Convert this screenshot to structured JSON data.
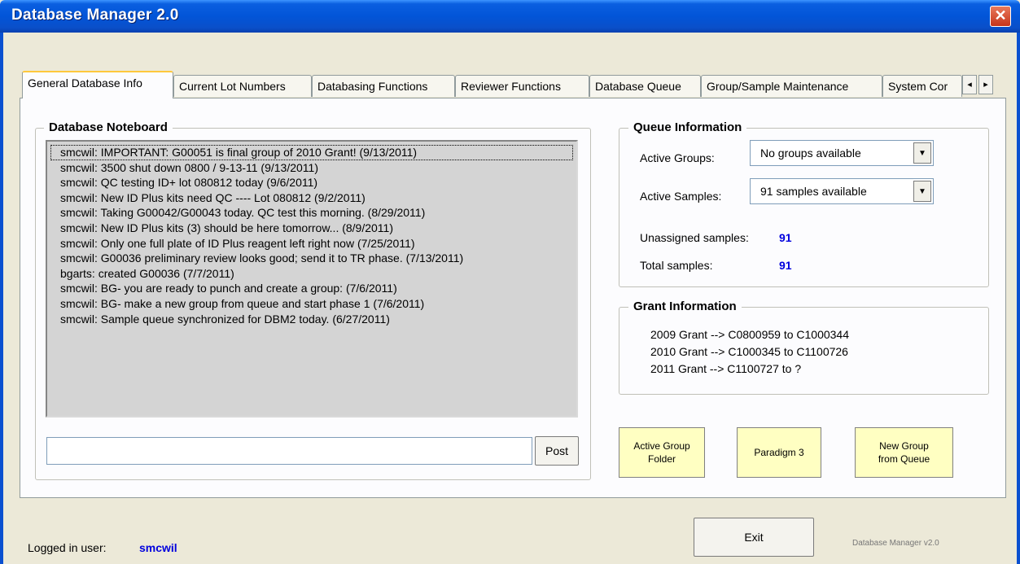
{
  "window": {
    "title": "Database Manager 2.0",
    "close_glyph": "✕"
  },
  "tabs": [
    {
      "label": "General Database Info"
    },
    {
      "label": "Current Lot Numbers"
    },
    {
      "label": "Databasing Functions"
    },
    {
      "label": "Reviewer Functions"
    },
    {
      "label": "Database Queue"
    },
    {
      "label": "Group/Sample Maintenance"
    },
    {
      "label": "System Cor"
    }
  ],
  "tab_scroll": {
    "left": "◂",
    "right": "▸"
  },
  "noteboard": {
    "title": "Database Noteboard",
    "notes": [
      "smcwil:  IMPORTANT:  G00051 is final group of 2010 Grant!   (9/13/2011)",
      "smcwil:  3500 shut down 0800 / 9-13-11   (9/13/2011)",
      "smcwil:  QC testing ID+ lot 080812 today   (9/6/2011)",
      "smcwil:  New ID Plus kits need QC ---- Lot 080812   (9/2/2011)",
      "smcwil:  Taking G00042/G00043 today.  QC test this morning.   (8/29/2011)",
      "smcwil:  New ID Plus kits (3) should be here tomorrow...   (8/9/2011)",
      "smcwil:  Only one full plate of ID Plus reagent left right now   (7/25/2011)",
      "smcwil:  G00036 preliminary review looks good; send it to TR phase.   (7/13/2011)",
      "bgarts:  created G00036   (7/7/2011)",
      "smcwil:  BG- you are ready to punch and create a group:   (7/6/2011)",
      "smcwil:  BG- make a new group from queue and start phase 1   (7/6/2011)",
      "smcwil:  Sample queue synchronized for DBM2 today.   (6/27/2011)"
    ],
    "input_value": "",
    "post_label": "Post"
  },
  "queue_info": {
    "title": "Queue Information",
    "active_groups_label": "Active Groups:",
    "active_groups_value": "No groups available",
    "active_samples_label": "Active Samples:",
    "active_samples_value": "91 samples available",
    "unassigned_label": "Unassigned samples:",
    "unassigned_value": "91",
    "total_label": "Total samples:",
    "total_value": "91"
  },
  "grant_info": {
    "title": "Grant Information",
    "lines": [
      "2009 Grant --> C0800959 to C1000344",
      "2010 Grant --> C1000345 to C1100726",
      "2011 Grant --> C1100727 to ?"
    ]
  },
  "action_buttons": {
    "active_group_folder": "Active Group\nFolder",
    "paradigm3": "Paradigm 3",
    "new_group": "New Group\nfrom Queue"
  },
  "footer": {
    "logged_in_label": "Logged in user:",
    "user": "smcwil",
    "exit_label": "Exit",
    "version": "Database Manager v2.0"
  },
  "colors": {
    "accent_blue": "#0000dd",
    "button_yellow": "#ffffc2",
    "title_bar": "#0255d8"
  }
}
